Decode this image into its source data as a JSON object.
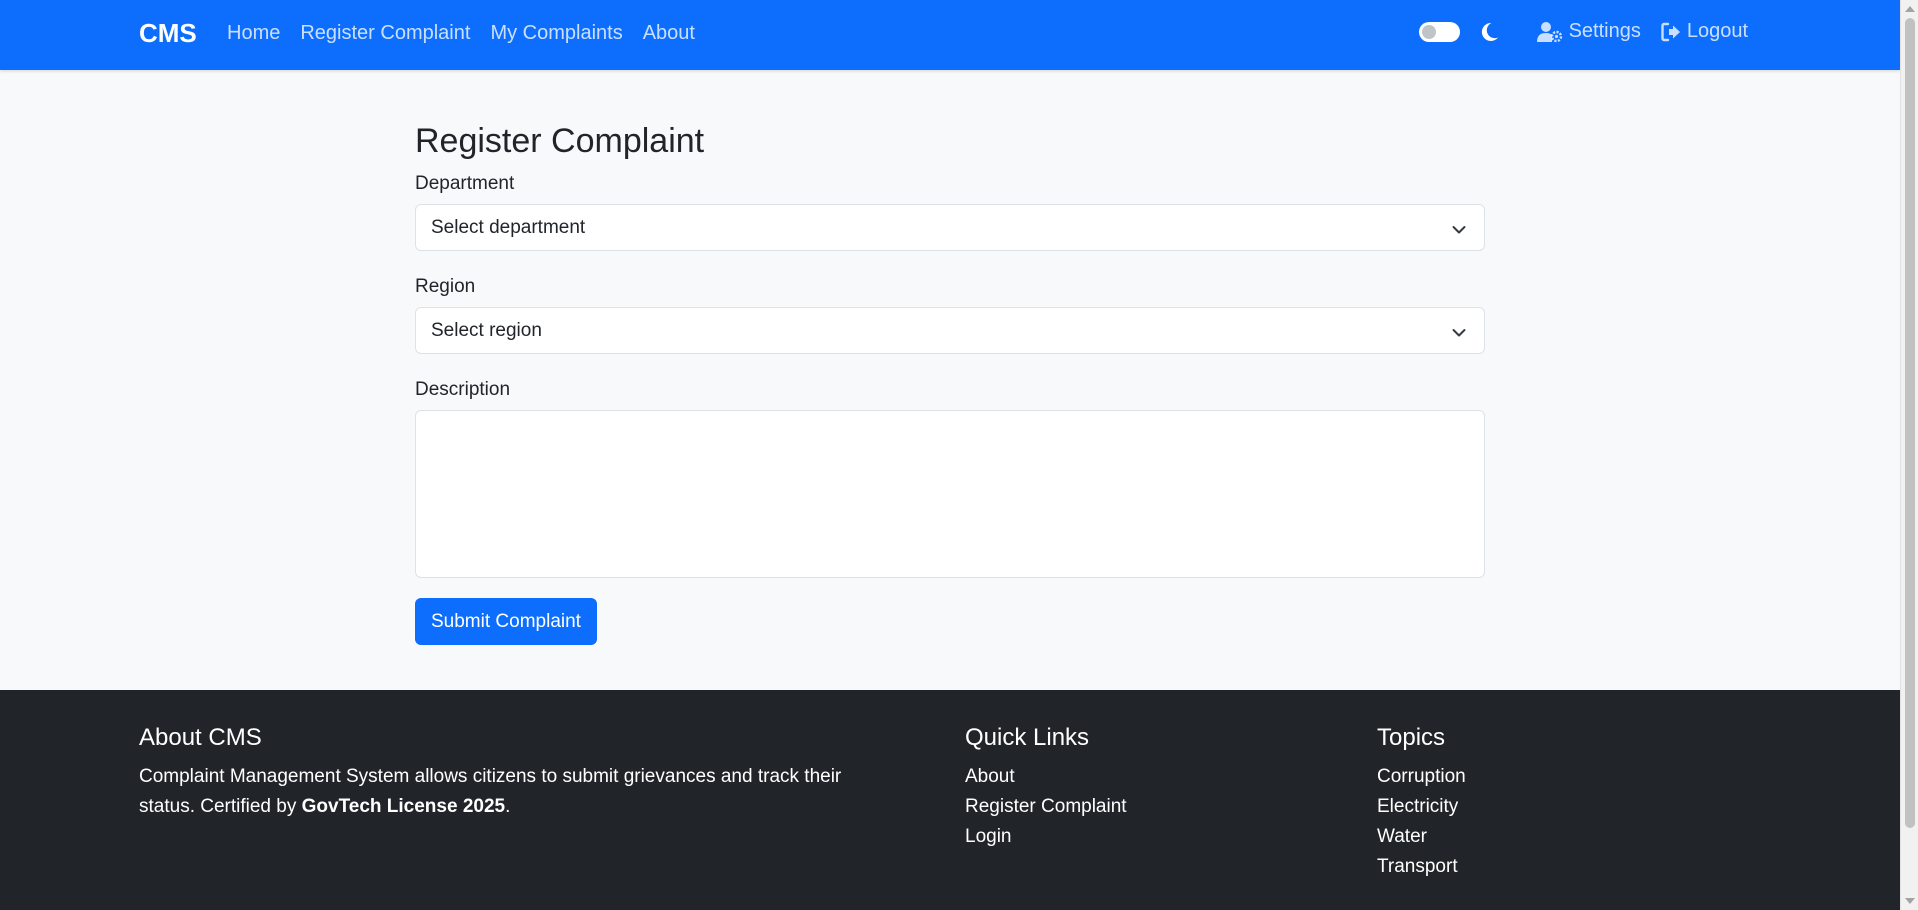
{
  "navbar": {
    "brand": "CMS",
    "links": [
      {
        "label": "Home"
      },
      {
        "label": "Register Complaint"
      },
      {
        "label": "My Complaints"
      },
      {
        "label": "About"
      }
    ],
    "settings_label": "Settings",
    "logout_label": "Logout",
    "dark_mode_toggle_on": false,
    "background_color": "#0d6efd"
  },
  "form": {
    "title": "Register Complaint",
    "department": {
      "label": "Department",
      "selected": "Select department"
    },
    "region": {
      "label": "Region",
      "selected": "Select region"
    },
    "description": {
      "label": "Description",
      "value": ""
    },
    "submit_label": "Submit Complaint"
  },
  "footer": {
    "about": {
      "heading": "About CMS",
      "text_before": "Complaint Management System allows citizens to submit grievances and track their status. Certified by ",
      "text_bold": "GovTech License 2025",
      "text_after": "."
    },
    "quick_links": {
      "heading": "Quick Links",
      "items": [
        {
          "label": "About"
        },
        {
          "label": "Register Complaint"
        },
        {
          "label": "Login"
        }
      ]
    },
    "topics": {
      "heading": "Topics",
      "items": [
        {
          "label": "Corruption"
        },
        {
          "label": "Electricity"
        },
        {
          "label": "Water"
        },
        {
          "label": "Transport"
        }
      ]
    },
    "background_color": "#212529"
  }
}
